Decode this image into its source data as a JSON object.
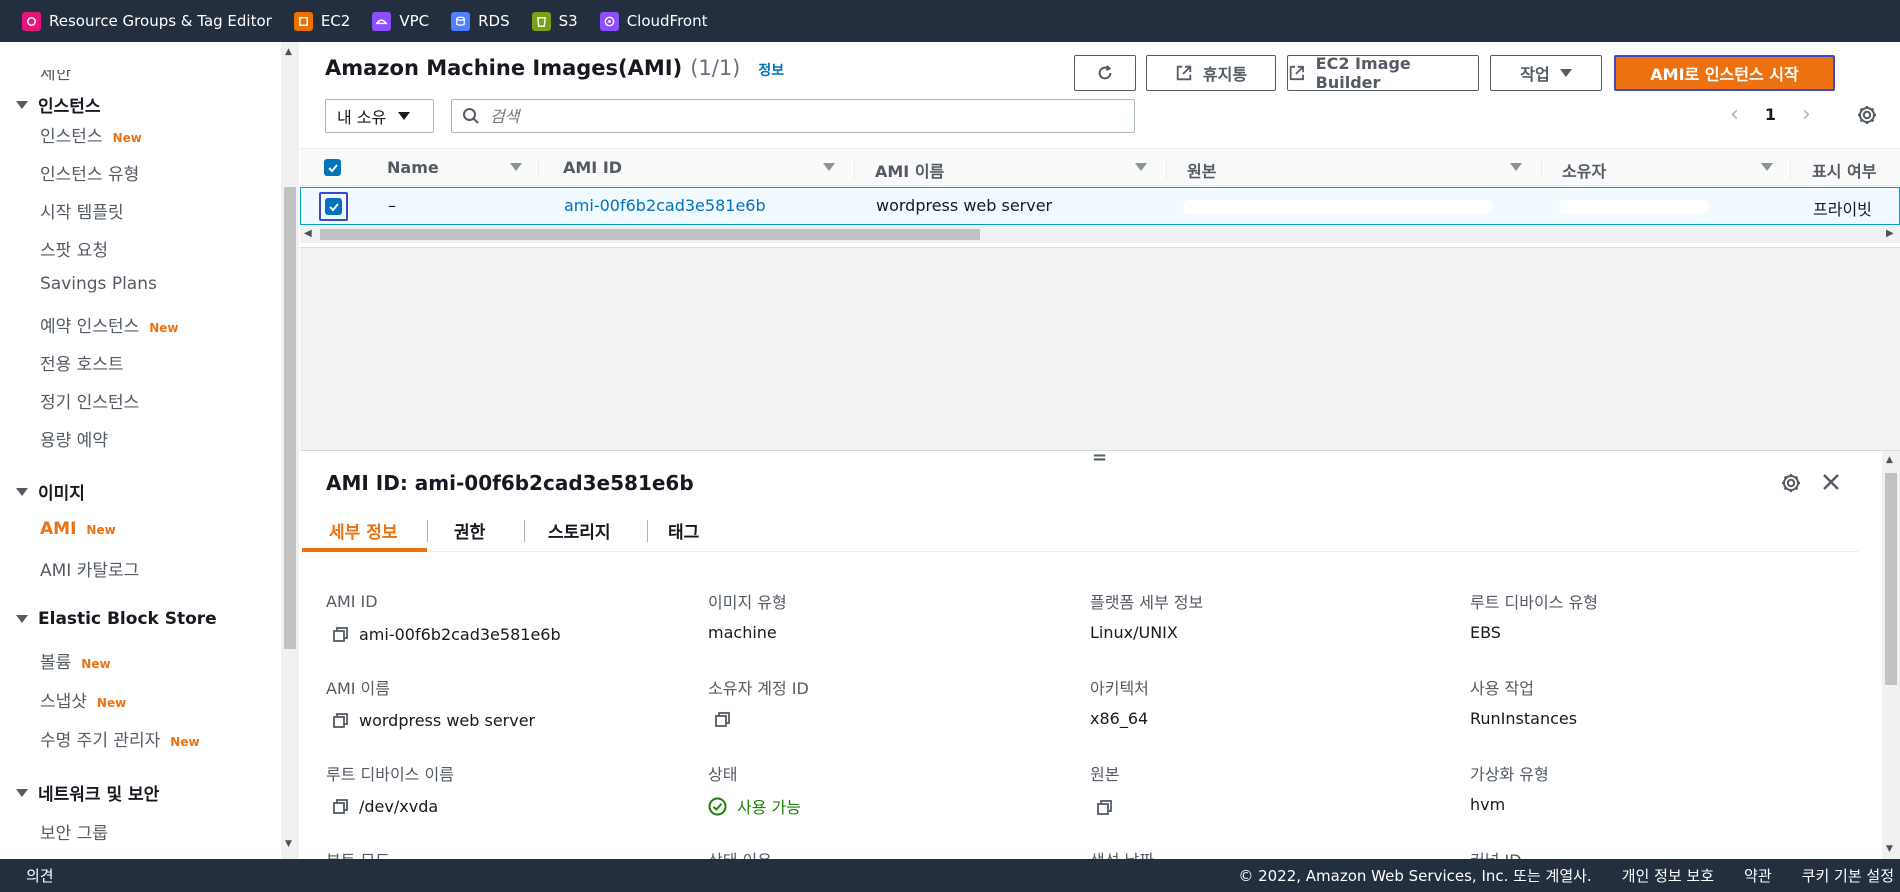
{
  "topbar": {
    "services": [
      {
        "label": "Resource Groups & Tag Editor",
        "color": "#e7157b"
      },
      {
        "label": "EC2",
        "color": "#ed7100"
      },
      {
        "label": "VPC",
        "color": "#8c4fff"
      },
      {
        "label": "RDS",
        "color": "#527fff"
      },
      {
        "label": "S3",
        "color": "#7aa116"
      },
      {
        "label": "CloudFront",
        "color": "#8c4fff"
      }
    ]
  },
  "sidebar": {
    "clipped_item": "세한",
    "sections": {
      "instances": "인스턴스",
      "images": "이미지",
      "ebs": "Elastic Block Store",
      "network": "네트워크 및 보안"
    },
    "items": {
      "instances": "인스턴스",
      "instance_types": "인스턴스 유형",
      "launch_templates": "시작 템플릿",
      "spot_requests": "스팟 요청",
      "savings_plans": "Savings Plans",
      "reserved_instances": "예약 인스턴스",
      "dedicated_hosts": "전용 호스트",
      "scheduled_instances": "정기 인스턴스",
      "capacity_reservations": "용량 예약",
      "ami": "AMI",
      "ami_catalog": "AMI 카탈로그",
      "volumes": "볼륨",
      "snapshots": "스냅샷",
      "lifecycle_manager": "수명 주기 관리자",
      "security_groups": "보안 그룹"
    },
    "new_badge": "New"
  },
  "header": {
    "title": "Amazon Machine Images(AMI)",
    "count": "(1/1)",
    "info": "정보",
    "buttons": {
      "recycle_bin": "휴지통",
      "image_builder": "EC2 Image Builder",
      "actions": "작업",
      "launch": "AMI로 인스턴스 시작"
    },
    "filter": "내 소유",
    "search_placeholder": "검색",
    "page": "1"
  },
  "table": {
    "headers": {
      "name": "Name",
      "ami_id": "AMI ID",
      "ami_name": "AMI 이름",
      "source": "원본",
      "owner": "소유자",
      "visibility": "표시 여부"
    },
    "row": {
      "name": "–",
      "ami_id": "ami-00f6b2cad3e581e6b",
      "ami_name": "wordpress web server",
      "visibility": "프라이빗"
    }
  },
  "detail": {
    "title": "AMI ID: ami-00f6b2cad3e581e6b",
    "tabs": [
      "세부 정보",
      "권한",
      "스토리지",
      "태그"
    ],
    "fields": {
      "ami_id_label": "AMI ID",
      "ami_id_value": "ami-00f6b2cad3e581e6b",
      "image_type_label": "이미지 유형",
      "image_type_value": "machine",
      "platform_label": "플랫폼 세부 정보",
      "platform_value": "Linux/UNIX",
      "root_device_type_label": "루트 디바이스 유형",
      "root_device_type_value": "EBS",
      "ami_name_label": "AMI 이름",
      "ami_name_value": "wordpress web server",
      "owner_label": "소유자 계정 ID",
      "arch_label": "아키텍처",
      "arch_value": "x86_64",
      "usage_label": "사용 작업",
      "usage_value": "RunInstances",
      "root_device_name_label": "루트 디바이스 이름",
      "root_device_name_value": "/dev/xvda",
      "state_label": "상태",
      "state_value": "사용 가능",
      "source_label": "원본",
      "virt_label": "가상화 유형",
      "virt_value": "hvm",
      "boot_mode_label": "부트 모드",
      "state_reason_label": "상태 이유",
      "creation_date_label": "생성 날짜",
      "kernel_label": "커널 ID"
    }
  },
  "footer": {
    "feedback": "의견",
    "copyright": "© 2022, Amazon Web Services, Inc. 또는 계열사.",
    "privacy": "개인 정보 보호",
    "terms": "약관",
    "cookies": "쿠키 기본 설정"
  }
}
